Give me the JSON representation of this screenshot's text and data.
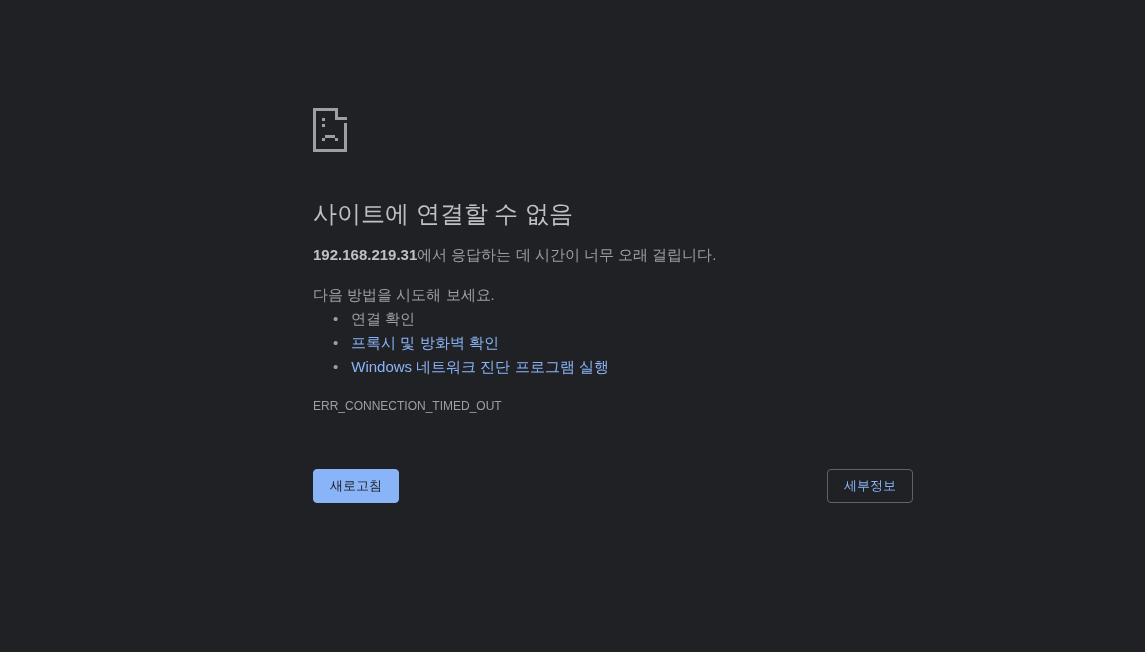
{
  "heading": "사이트에 연결할 수 없음",
  "summary": "**192.168.219.31**에서 응답하는 데 시간이 너무 오래 걸립니다.",
  "suggestions_intro": "다음 방법을 시도해 보세요.",
  "suggestions": [
    {
      "kind": "text",
      "bullet": "•",
      "label": "연결 확인"
    },
    {
      "kind": "link",
      "bullet": "•",
      "label": "프록시 및 방화벽 확인"
    },
    {
      "kind": "link",
      "bullet": "•",
      "label": "Windows 네트워크 진단 프로그램 실행"
    }
  ],
  "error_code": "ERR_CONNECTION_TIMED_OUT",
  "buttons": [
    {
      "kind": "primary",
      "label": "새로고침"
    },
    {
      "kind": "secondary",
      "label": "세부정보"
    }
  ]
}
